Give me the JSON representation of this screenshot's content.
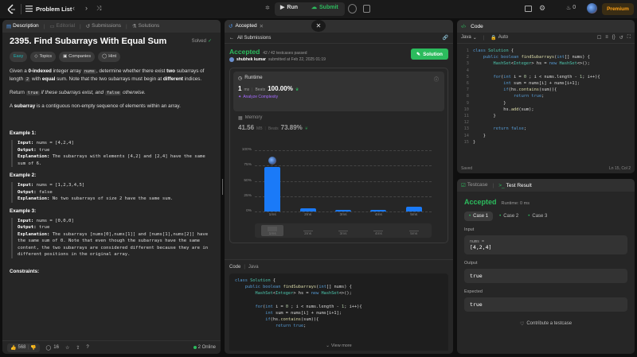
{
  "topbar": {
    "problem_list": "Problem List",
    "run": "Run",
    "submit": "Submit",
    "streak": "0",
    "premium": "Premium"
  },
  "left": {
    "tabs": {
      "description": "Description",
      "editorial": "Editorial",
      "submissions": "Submissions",
      "solutions": "Solutions"
    },
    "title": "2395. Find Subarrays With Equal Sum",
    "solved": "Solved",
    "tags": {
      "difficulty": "Easy",
      "topics": "Topics",
      "companies": "Companies",
      "hint": "Hint"
    },
    "p1": {
      "a": "Given a ",
      "b": "0-indexed",
      "c": " integer array ",
      "d": "nums",
      "e": ", determine whether there exist ",
      "f": "two",
      "g": " subarrays of length ",
      "h": "2",
      "i": " with ",
      "j": "equal",
      "k": " sum. Note that the two subarrays must begin at ",
      "l": "different",
      "m": " indices."
    },
    "p2": {
      "a": "Return ",
      "b": "true",
      "c": " if these subarrays exist, and ",
      "d": "false",
      "e": " otherwise."
    },
    "p3": {
      "a": "A ",
      "b": "subarray",
      "c": " is a contiguous non-empty sequence of elements within an array."
    },
    "examples": [
      {
        "title": "Example 1:",
        "input": " nums = [4,2,4]",
        "output": " true",
        "explanation": " The subarrays with elements [4,2] and [2,4] have the same sum of 6."
      },
      {
        "title": "Example 2:",
        "input": " nums = [1,2,3,4,5]",
        "output": " false",
        "explanation": " No two subarrays of size 2 have the same sum."
      },
      {
        "title": "Example 3:",
        "input": " nums = [0,0,0]",
        "output": " true",
        "explanation": " The subarrays [nums[0],nums[1]] and [nums[1],nums[2]] have the same sum of 0. Note that even though the subarrays have the same content, the two subarrays are considered different because they are in different positions in the original array."
      }
    ],
    "labels": {
      "input": "Input:",
      "output": "Output:",
      "explanation": "Explanation:"
    },
    "constraints": "Constraints:",
    "footer": {
      "likes": "568",
      "comments": "16",
      "online": "2 Online"
    }
  },
  "middle": {
    "tab": "Accepted",
    "all_submissions": "All Submissions",
    "status": "Accepted",
    "testcases": "42 / 42 testcases passed",
    "user": "shubhek kumar",
    "submitted": "submitted at Feb 22, 2025 01:19",
    "solution_btn": "Solution",
    "runtime": {
      "label": "Runtime",
      "value": "1",
      "unit": "ms",
      "beats_label": "Beats",
      "beats": "100.00%",
      "analyze": "Analyze Complexity"
    },
    "memory": {
      "label": "Memory",
      "value": "41.56",
      "unit": "MB",
      "beats_label": "Beats",
      "beats": "73.89%"
    },
    "chart_data": {
      "type": "bar",
      "categories": [
        "1ms",
        "2ms",
        "3ms",
        "4ms",
        "5ms"
      ],
      "values": [
        73,
        5,
        3,
        3,
        8
      ],
      "yticks": [
        "100%",
        "75%",
        "50%",
        "25%",
        "0%"
      ],
      "ylim": [
        0,
        100
      ],
      "highlight": "1ms",
      "color": "#1a7af8"
    },
    "code_header": {
      "label": "Code",
      "lang": "Java"
    },
    "code_lines": [
      "class Solution {",
      "    public boolean findSubarrays(int[] nums) {",
      "        HashSet<Integer> hs = new HashSet<>();",
      "",
      "        for(int i = 0 ; i < nums.length - 1; i++){",
      "            int sum = nums[i] + nums[i+1];",
      "            if(hs.contains(sum)){",
      "                return true;"
    ],
    "view_more": "View more"
  },
  "code_panel": {
    "title": "Code",
    "lang": "Java",
    "auto": "Auto",
    "lines": [
      "class Solution {",
      "    public boolean findSubarrays(int[] nums) {",
      "        HashSet<Integer> hs = new HashSet<>();",
      "",
      "        for(int i = 0 ; i < nums.length - 1; i++){",
      "            int sum = nums[i] + nums[i+1];",
      "            if(hs.contains(sum)){",
      "                return true;",
      "            }",
      "            hs.add(sum);",
      "        }",
      "",
      "        return false;",
      "    }",
      "}"
    ],
    "saved": "Saved",
    "cursor": "Ln 15, Col 2"
  },
  "test_panel": {
    "tab_testcase": "Testcase",
    "tab_result": "Test Result",
    "status": "Accepted",
    "runtime": "Runtime: 0 ms",
    "cases": [
      "Case 1",
      "Case 2",
      "Case 3"
    ],
    "input_label": "Input",
    "input_var": "nums =",
    "input_value": "[4,2,4]",
    "output_label": "Output",
    "output_value": "true",
    "expected_label": "Expected",
    "expected_value": "true",
    "contribute": "Contribute a testcase"
  }
}
